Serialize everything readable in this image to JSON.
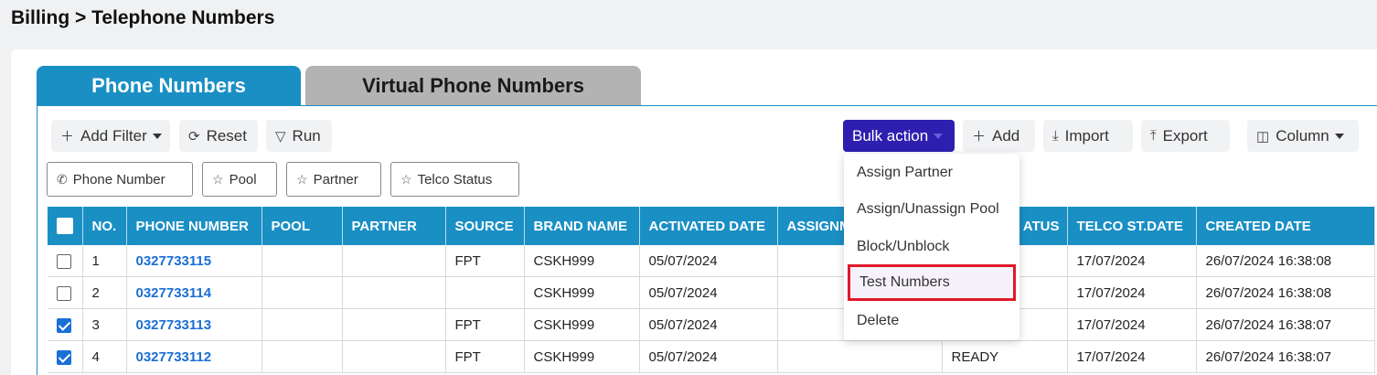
{
  "breadcrumb": "Billing > Telephone Numbers",
  "tabs": [
    {
      "label": "Phone Numbers",
      "active": true
    },
    {
      "label": "Virtual Phone Numbers",
      "active": false
    }
  ],
  "toolbar": {
    "add_filter": "Add Filter",
    "reset": "Reset",
    "run": "Run",
    "bulk_action": "Bulk action",
    "add": "Add",
    "import": "Import",
    "export": "Export",
    "column": "Column"
  },
  "filters": [
    "Phone Number",
    "Pool",
    "Partner",
    "Telco Status"
  ],
  "bulk_menu": [
    "Assign Partner",
    "Assign/Unassign Pool",
    "Block/Unblock",
    "Test Numbers",
    "Delete"
  ],
  "table": {
    "headers": [
      "NO.",
      "PHONE NUMBER",
      "POOL",
      "PARTNER",
      "SOURCE",
      "BRAND NAME",
      "ACTIVATED DATE",
      "ASSIGNM",
      "ATUS",
      "TELCO ST.DATE",
      "CREATED DATE"
    ],
    "rows": [
      {
        "checked": false,
        "no": "1",
        "phone": "0327733115",
        "pool": "",
        "partner": "",
        "source": "FPT",
        "brand": "CSKH999",
        "activated": "05/07/2024",
        "assign": "",
        "status": "",
        "telco_date": "17/07/2024",
        "created": "26/07/2024 16:38:08"
      },
      {
        "checked": false,
        "no": "2",
        "phone": "0327733114",
        "pool": "",
        "partner": "",
        "source": "",
        "brand": "CSKH999",
        "activated": "05/07/2024",
        "assign": "",
        "status": "",
        "telco_date": "17/07/2024",
        "created": "26/07/2024 16:38:08"
      },
      {
        "checked": true,
        "no": "3",
        "phone": "0327733113",
        "pool": "",
        "partner": "",
        "source": "FPT",
        "brand": "CSKH999",
        "activated": "05/07/2024",
        "assign": "",
        "status": "",
        "telco_date": "17/07/2024",
        "created": "26/07/2024 16:38:07"
      },
      {
        "checked": true,
        "no": "4",
        "phone": "0327733112",
        "pool": "",
        "partner": "",
        "source": "FPT",
        "brand": "CSKH999",
        "activated": "05/07/2024",
        "assign": "",
        "status": "READY",
        "telco_date": "17/07/2024",
        "created": "26/07/2024 16:38:07"
      }
    ]
  },
  "colors": {
    "accent": "#1a8fc4",
    "bulk": "#2d1fb0",
    "highlight": "#e0192a",
    "link": "#1a6fd6"
  }
}
